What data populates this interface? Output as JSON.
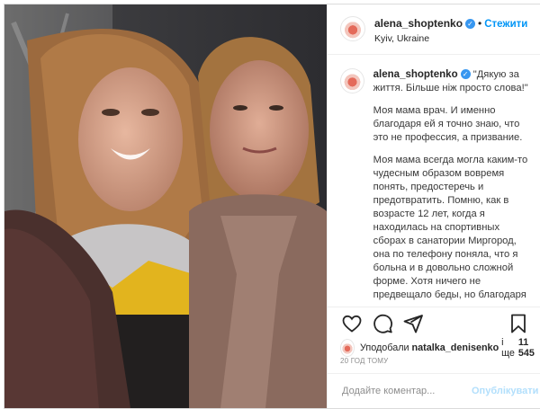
{
  "header": {
    "username": "alena_shoptenko",
    "separator": "•",
    "follow_label": "Стежити",
    "location": "Kyiv, Ukraine"
  },
  "caption": {
    "username": "alena_shoptenko",
    "paragraphs": [
      "\"Дякую за життя. Більше ніж просто слова!\"",
      "Моя мама врач. И именно благодаря ей я точно знаю, что это не профессия, а призвание.",
      "Моя мама всегда могла каким-то чудесным образом вовремя понять, предостеречь и предотвратить. Помню, как в возрасте 12 лет, когда я находилась на спортивных сборах в санатории Миргород, она по телефону поняла, что я больна и в довольно сложной форме. Хотя ничего не предвещало беды, но благодаря ей меня срочно посадили на поезд в Киев и с вокзала уже увозили в больницу. Оказалось, она была права."
    ]
  },
  "actions": {
    "icons": [
      "heart-icon",
      "comment-icon",
      "share-icon",
      "bookmark-icon"
    ]
  },
  "likes": {
    "prefix": "Уподобали",
    "liker": "natalka_denisenko",
    "connector": "і ще",
    "count": "11 545"
  },
  "timestamp": "20 ГОД ТОМУ",
  "comment": {
    "placeholder": "Додайте коментар...",
    "publish_label": "Опублікувати"
  },
  "colors": {
    "accent": "#0095f6",
    "publish_disabled": "#b2dffc",
    "verified": "#3897f0"
  }
}
